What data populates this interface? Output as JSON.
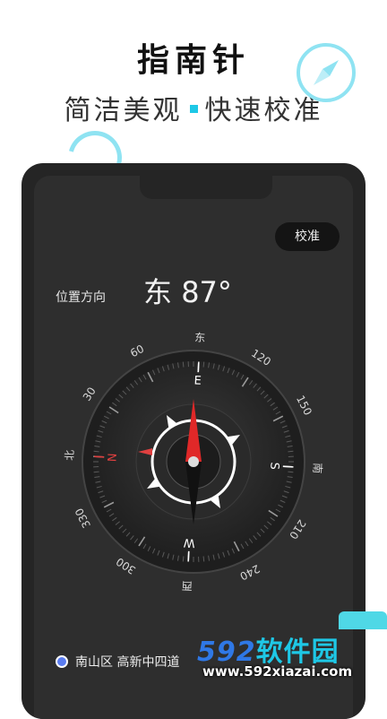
{
  "hero": {
    "title": "指南针",
    "subtitle_left": "简洁美观",
    "subtitle_right": "快速校准"
  },
  "toolbar": {
    "calibrate_label": "校准"
  },
  "readout": {
    "position_label": "位置方向",
    "direction": "东",
    "angle": "87°"
  },
  "compass": {
    "heading_degrees": 87,
    "outer_labels": [
      {
        "text": "北",
        "deg": 0
      },
      {
        "text": "30",
        "deg": 30
      },
      {
        "text": "60",
        "deg": 60
      },
      {
        "text": "东",
        "deg": 90
      },
      {
        "text": "120",
        "deg": 120
      },
      {
        "text": "150",
        "deg": 150
      },
      {
        "text": "南",
        "deg": 180
      },
      {
        "text": "210",
        "deg": 210
      },
      {
        "text": "240",
        "deg": 240
      },
      {
        "text": "西",
        "deg": 270
      },
      {
        "text": "300",
        "deg": 300
      },
      {
        "text": "330",
        "deg": 330
      }
    ],
    "cardinals": [
      {
        "text": "N",
        "deg": 0,
        "color": "#e04040"
      },
      {
        "text": "E",
        "deg": 90,
        "color": "#ffffff"
      },
      {
        "text": "S",
        "deg": 180,
        "color": "#ffffff"
      },
      {
        "text": "W",
        "deg": 270,
        "color": "#ffffff"
      }
    ],
    "needle_color": "#e02828"
  },
  "location": {
    "text": "南山区 高新中四道"
  },
  "watermark": {
    "logo_number": "592",
    "logo_text": "软件园",
    "url": "www.592xiazai.com"
  },
  "colors": {
    "accent": "#1ec8e6",
    "phone_bg": "#252525",
    "screen_bg": "#2e2e2e"
  }
}
